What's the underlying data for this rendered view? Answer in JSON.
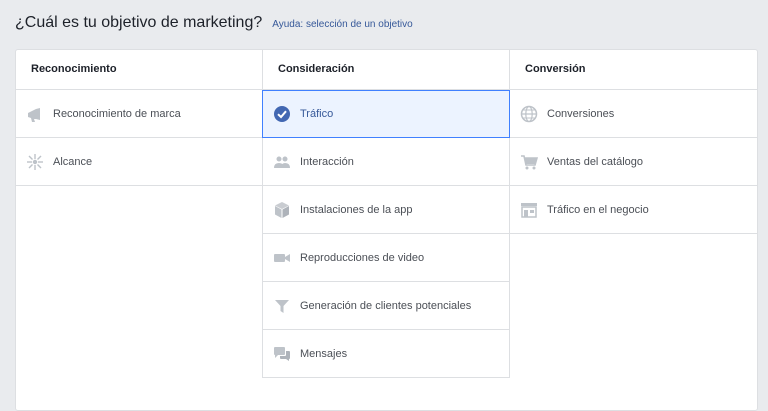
{
  "header": {
    "title": "¿Cuál es tu objetivo de marketing?",
    "help_link": "Ayuda: selección de un objetivo"
  },
  "columns": [
    {
      "title": "Reconocimiento",
      "options": [
        {
          "label": "Reconocimiento de marca",
          "icon": "megaphone-icon"
        },
        {
          "label": "Alcance",
          "icon": "reach-icon"
        }
      ]
    },
    {
      "title": "Consideración",
      "options": [
        {
          "label": "Tráfico",
          "icon": "check-icon",
          "selected": true
        },
        {
          "label": "Interacción",
          "icon": "people-icon"
        },
        {
          "label": "Instalaciones de la app",
          "icon": "box-icon"
        },
        {
          "label": "Reproducciones de video",
          "icon": "video-icon"
        },
        {
          "label": "Generación de clientes potenciales",
          "icon": "funnel-icon"
        },
        {
          "label": "Mensajes",
          "icon": "chat-icon"
        }
      ]
    },
    {
      "title": "Conversión",
      "options": [
        {
          "label": "Conversiones",
          "icon": "globe-icon"
        },
        {
          "label": "Ventas del catálogo",
          "icon": "cart-icon"
        },
        {
          "label": "Tráfico en el negocio",
          "icon": "store-icon"
        }
      ]
    }
  ],
  "colors": {
    "accent": "#4080ff",
    "selected_bg": "#ecf3ff",
    "icon_gray": "#bec3c9",
    "link": "#365899"
  }
}
